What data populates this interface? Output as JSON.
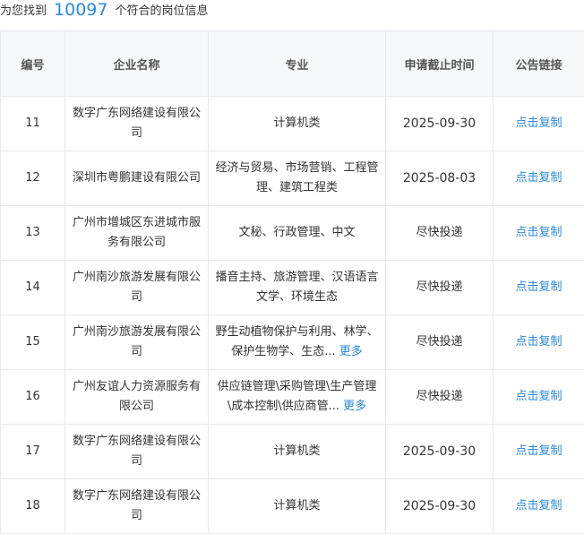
{
  "summary": {
    "prefix": "为您找到",
    "count": "10097",
    "suffix": "个符合的岗位信息"
  },
  "table": {
    "headers": [
      "编号",
      "企业名称",
      "专业",
      "申请截止时间",
      "公告链接"
    ],
    "rows": [
      {
        "id": "11",
        "company": "数字广东网络建设有限公司",
        "major": "计算机类",
        "major_more": "",
        "deadline": "2025-09-30",
        "link": "点击复制"
      },
      {
        "id": "12",
        "company": "深圳市粤鹏建设有限公司",
        "major": "经济与贸易、市场营销、工程管理、建筑工程类",
        "major_more": "",
        "deadline": "2025-08-03",
        "link": "点击复制"
      },
      {
        "id": "13",
        "company": "广州市增城区东进城市服务有限公司",
        "major": "文秘、行政管理、中文",
        "major_more": "",
        "deadline": "尽快投递",
        "link": "点击复制"
      },
      {
        "id": "14",
        "company": "广州南沙旅游发展有限公司",
        "major": "播音主持、旅游管理、汉语语言文学、环境生态",
        "major_more": "",
        "deadline": "尽快投递",
        "link": "点击复制"
      },
      {
        "id": "15",
        "company": "广州南沙旅游发展有限公司",
        "major": "野生动植物保护与利用、林学、保护生物学、生态...",
        "major_more": "更多",
        "deadline": "尽快投递",
        "link": "点击复制"
      },
      {
        "id": "16",
        "company": "广州友谊人力资源服务有限公司",
        "major": "供应链管理\\采购管理\\生产管理\\成本控制\\供应商管...",
        "major_more": "更多",
        "deadline": "尽快投递",
        "link": "点击复制"
      },
      {
        "id": "17",
        "company": "数字广东网络建设有限公司",
        "major": "计算机类",
        "major_more": "",
        "deadline": "2025-09-30",
        "link": "点击复制"
      },
      {
        "id": "18",
        "company": "数字广东网络建设有限公司",
        "major": "计算机类",
        "major_more": "",
        "deadline": "2025-09-30",
        "link": "点击复制"
      }
    ]
  }
}
